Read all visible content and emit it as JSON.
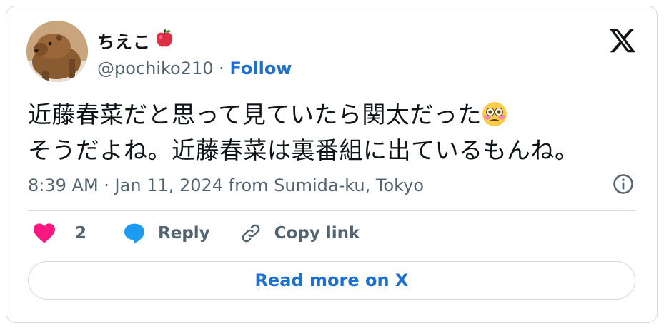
{
  "author": {
    "display_name": "ちえこ",
    "handle": "@pochiko210",
    "separator": "·",
    "follow_label": "Follow"
  },
  "tweet": {
    "lines": [
      "近藤春菜だと思って見ていたら関太だった",
      "そうだよね。近藤春菜は裏番組に出ているもんね。"
    ],
    "timestamp": "8:39 AM · Jan 11, 2024 from Sumida-ku, Tokyo"
  },
  "actions": {
    "like_count": "2",
    "reply_label": "Reply",
    "copy_link_label": "Copy link"
  },
  "read_more_label": "Read more on X",
  "icons": {
    "author_badge": "red-apple-icon",
    "line1_end": "flushed-face-emoji-icon",
    "brand": "x-logo-icon",
    "info": "info-icon",
    "like": "heart-icon",
    "reply": "speech-bubble-icon",
    "copy": "link-icon"
  },
  "colors": {
    "link_blue": "#1d6fd1",
    "heart": "#f91880",
    "reply_bubble": "#1d9bf0",
    "muted_text": "#536471",
    "border": "#cfd9de"
  }
}
